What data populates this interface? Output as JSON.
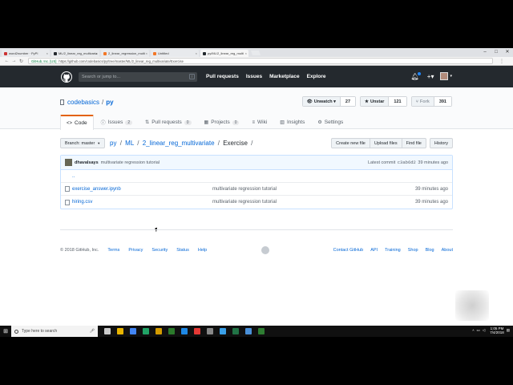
{
  "browser": {
    "tabs": [
      {
        "title": "word2number · PyPI",
        "active": false
      },
      {
        "title": "ML/2_linear_reg_multivaria",
        "active": false
      },
      {
        "title": "2_linear_regression_multi",
        "active": false
      },
      {
        "title": "Untitled",
        "active": false
      },
      {
        "title": "py/ML/2_linear_reg_multi",
        "active": true
      }
    ],
    "window_controls": [
      "–",
      "□",
      "✕"
    ],
    "security_label": "GitHub, Inc. [US]",
    "url": "https://github.com/codebasics/py/tree/master/ML/2_linear_reg_multivariate/Exercise"
  },
  "github_header": {
    "search_placeholder": "Search or jump to...",
    "search_key": "/",
    "nav": [
      "Pull requests",
      "Issues",
      "Marketplace",
      "Explore"
    ],
    "plus": "+▾",
    "avatar_caret": "▾"
  },
  "repo": {
    "owner": "codebasics",
    "separator": "/",
    "name": "py",
    "watch_label": "Unwatch ▾",
    "watch_count": "27",
    "star_label": "Unstar",
    "star_count": "121",
    "fork_label": "Fork",
    "fork_count": "391",
    "tabs": [
      {
        "icon": "<>",
        "label": "Code",
        "count": ""
      },
      {
        "icon": "ⓘ",
        "label": "Issues",
        "count": "2"
      },
      {
        "icon": "⇅",
        "label": "Pull requests",
        "count": "0"
      },
      {
        "icon": "▦",
        "label": "Projects",
        "count": "0"
      },
      {
        "icon": "≡",
        "label": "Wiki",
        "count": ""
      },
      {
        "icon": "▥",
        "label": "Insights",
        "count": ""
      },
      {
        "icon": "⚙",
        "label": "Settings",
        "count": ""
      }
    ]
  },
  "file_nav": {
    "branch_label": "Branch: master",
    "crumbs": [
      "py",
      "ML",
      "2_linear_reg_multivariate"
    ],
    "current": "Exercise",
    "trail": "/",
    "buttons": [
      "Create new file",
      "Upload files",
      "Find file"
    ],
    "history": "History"
  },
  "commit": {
    "author": "dhavalsays",
    "message": "multivariate regression tutorial",
    "latest_label": "Latest commit",
    "sha": "c3ab6d2",
    "age": "39 minutes ago"
  },
  "files": {
    "up": "..",
    "rows": [
      {
        "name": "exercise_answer.ipynb",
        "message": "multivariate regression tutorial",
        "age": "39 minutes ago"
      },
      {
        "name": "hiring.csv",
        "message": "multivariate regression tutorial",
        "age": "39 minutes ago"
      }
    ]
  },
  "footer": {
    "copyright": "© 2018 GitHub, Inc.",
    "left_links": [
      "Terms",
      "Privacy",
      "Security",
      "Status",
      "Help"
    ],
    "right_links": [
      "Contact GitHub",
      "API",
      "Training",
      "Shop",
      "Blog",
      "About"
    ]
  },
  "taskbar": {
    "search_placeholder": "Type here to search",
    "time": "1:05 PM",
    "date": "7/4/2018",
    "app_colors": [
      "#cccccc",
      "#e8b400",
      "#4285f4",
      "#21a366",
      "#d49b00",
      "#2b7a2b",
      "#1e88e5",
      "#e53935",
      "#888888",
      "#3aa0e8",
      "#217346",
      "#4a90d9",
      "#2e7d32"
    ]
  }
}
